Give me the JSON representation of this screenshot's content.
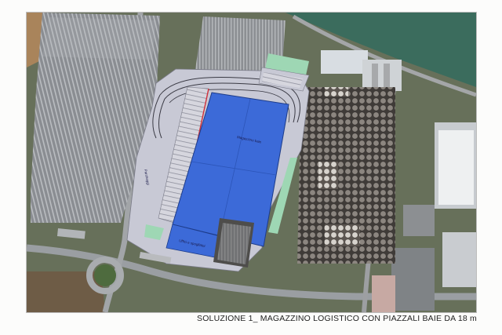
{
  "caption": "SOLUZIONE 1_ MAGAZZINO LOGISTICO CON PIAZZALI BAIE DA 18 m",
  "map": {
    "labels": {
      "warehouse_area": "Magazzino baie",
      "office_area": "Uffici e spogliatoi",
      "parking_label": "Parcheggi"
    }
  },
  "colors": {
    "warehouse_blue": "#3c6ad8",
    "lot_grey": "#c9cad6",
    "green_strip": "#9ed7b4",
    "terrain": "#5d6a4e",
    "roof_grey": "#8b8e92",
    "sea": "#3a6b5a"
  }
}
